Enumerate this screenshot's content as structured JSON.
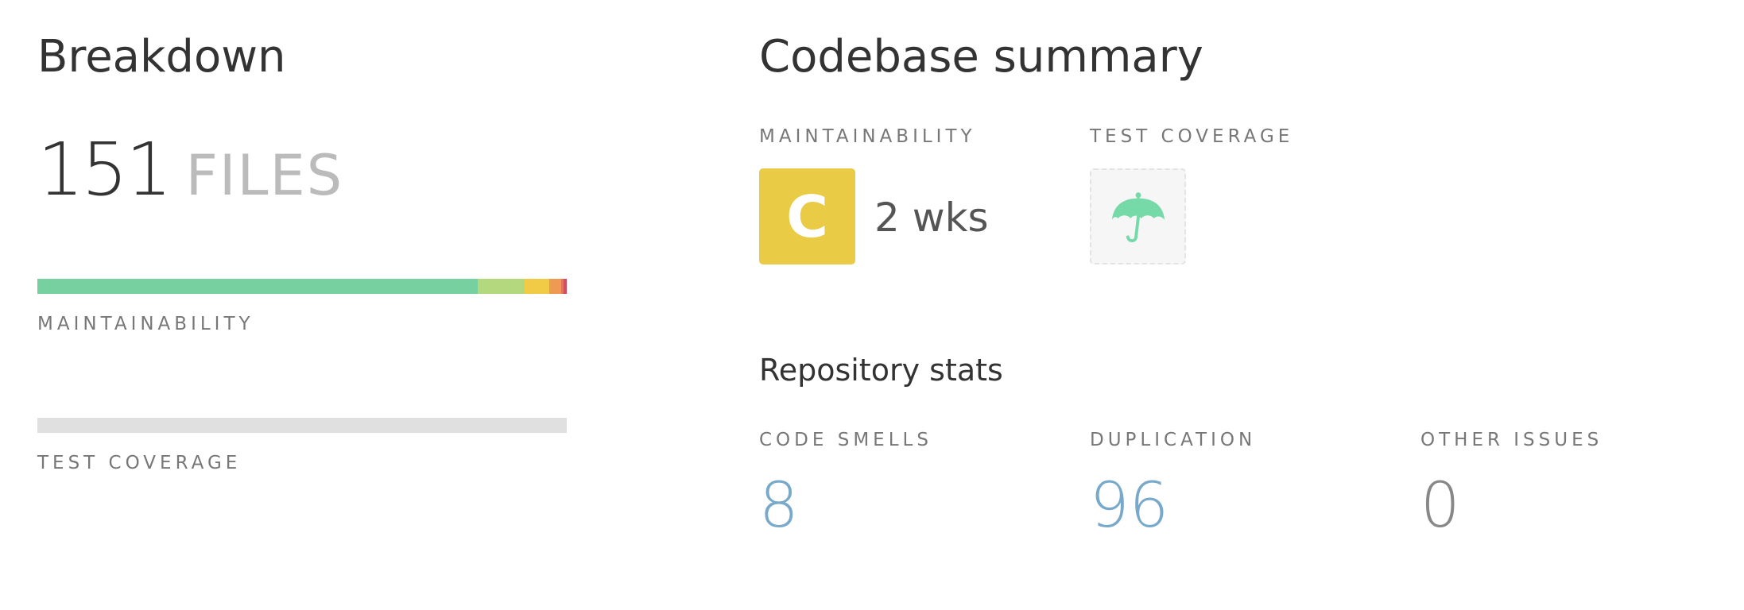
{
  "breakdown": {
    "title": "Breakdown",
    "file_count": "151",
    "file_unit": "FILES",
    "maintainability_label": "MAINTAINABILITY",
    "maintainability_distribution": [
      {
        "grade": "A",
        "fraction": 0.832,
        "color": "#76d0a0"
      },
      {
        "grade": "B",
        "fraction": 0.088,
        "color": "#b3d87e"
      },
      {
        "grade": "C",
        "fraction": 0.047,
        "color": "#f1ca46"
      },
      {
        "grade": "D",
        "fraction": 0.022,
        "color": "#ef9a52"
      },
      {
        "grade": "E",
        "fraction": 0.005,
        "color": "#e2735d"
      },
      {
        "grade": "F",
        "fraction": 0.006,
        "color": "#d64a6a"
      }
    ],
    "test_coverage_label": "TEST COVERAGE",
    "test_coverage_bar_color": "#e0e0e0"
  },
  "summary": {
    "title": "Codebase summary",
    "maintainability_label": "MAINTAINABILITY",
    "maintainability_grade": "C",
    "maintainability_grade_color": "#eacb45",
    "technical_debt": "2 wks",
    "test_coverage_label": "TEST COVERAGE",
    "test_coverage_icon": "umbrella-icon",
    "test_coverage_icon_color": "#76d9a8"
  },
  "repository_stats": {
    "title": "Repository stats",
    "stats": [
      {
        "label": "CODE SMELLS",
        "value": "8",
        "color": "#78a9cb"
      },
      {
        "label": "DUPLICATION",
        "value": "96",
        "color": "#78a9cb"
      },
      {
        "label": "OTHER ISSUES",
        "value": "0",
        "color": "#888888"
      }
    ]
  }
}
